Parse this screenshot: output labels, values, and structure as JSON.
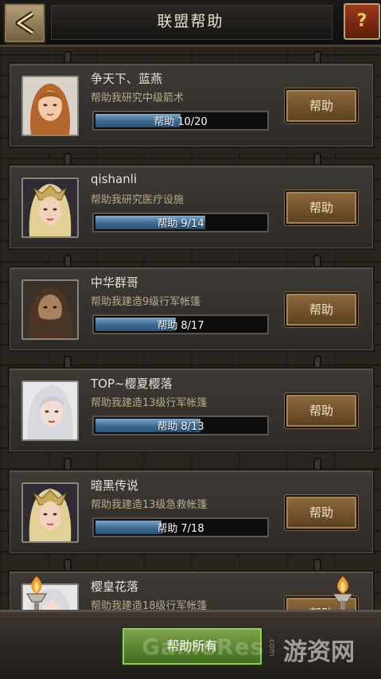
{
  "header": {
    "title": "联盟帮助",
    "help_symbol": "?"
  },
  "progress_word": "帮助",
  "requests": [
    {
      "name": "争天下、蓝燕",
      "task": "帮助我研究中级箭术",
      "progress_text": "10/20",
      "current": 10,
      "total": 20,
      "button": "帮助",
      "avatar": "auburn-hair-woman"
    },
    {
      "name": "qishanli",
      "task": "帮助我研究医疗设施",
      "progress_text": "9/14",
      "current": 9,
      "total": 14,
      "button": "帮助",
      "avatar": "blonde-helmet-woman"
    },
    {
      "name": "中华群哥",
      "task": "帮助我建造9级行军帐篷",
      "progress_text": "8/17",
      "current": 8,
      "total": 17,
      "button": "帮助",
      "avatar": "bearded-warrior"
    },
    {
      "name": "TOP~樱夏樱落",
      "task": "帮助我建造13级行军帐篷",
      "progress_text": "8/13",
      "current": 8,
      "total": 13,
      "button": "帮助",
      "avatar": "white-hair-woman"
    },
    {
      "name": "暗黑传说",
      "task": "帮助我建造13级急救帐篷",
      "progress_text": "7/18",
      "current": 7,
      "total": 18,
      "button": "帮助",
      "avatar": "blonde-helmet-woman"
    },
    {
      "name": "樱皇花落",
      "task": "帮助我建造18级行军帐篷",
      "progress_text": "",
      "current": 0,
      "total": 0,
      "button": "帮助",
      "avatar": "white-hair-woman"
    }
  ],
  "footer": {
    "help_all": "帮助所有"
  },
  "watermark": {
    "text": "GameRes",
    "cn": "游资网",
    "domain": ".com"
  },
  "colors": {
    "progress_fill": "#3a6892",
    "help_button": "#8e6a3d",
    "help_all_button": "#5f8a32"
  }
}
